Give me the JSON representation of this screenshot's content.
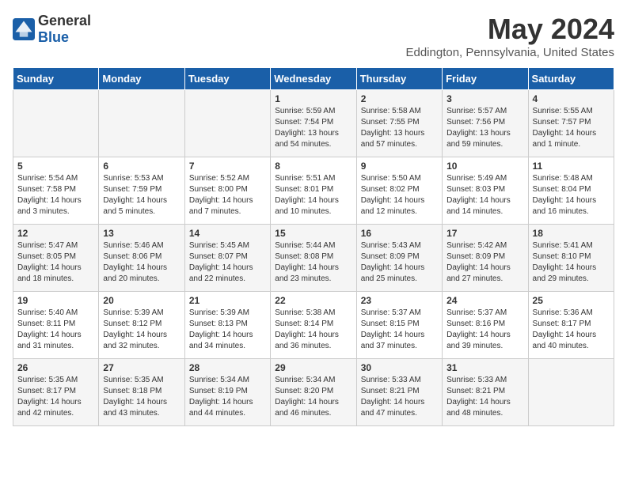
{
  "header": {
    "logo_general": "General",
    "logo_blue": "Blue",
    "title": "May 2024",
    "subtitle": "Eddington, Pennsylvania, United States"
  },
  "days_of_week": [
    "Sunday",
    "Monday",
    "Tuesday",
    "Wednesday",
    "Thursday",
    "Friday",
    "Saturday"
  ],
  "weeks": [
    [
      {
        "day": "",
        "info": ""
      },
      {
        "day": "",
        "info": ""
      },
      {
        "day": "",
        "info": ""
      },
      {
        "day": "1",
        "info": "Sunrise: 5:59 AM\nSunset: 7:54 PM\nDaylight: 13 hours\nand 54 minutes."
      },
      {
        "day": "2",
        "info": "Sunrise: 5:58 AM\nSunset: 7:55 PM\nDaylight: 13 hours\nand 57 minutes."
      },
      {
        "day": "3",
        "info": "Sunrise: 5:57 AM\nSunset: 7:56 PM\nDaylight: 13 hours\nand 59 minutes."
      },
      {
        "day": "4",
        "info": "Sunrise: 5:55 AM\nSunset: 7:57 PM\nDaylight: 14 hours\nand 1 minute."
      }
    ],
    [
      {
        "day": "5",
        "info": "Sunrise: 5:54 AM\nSunset: 7:58 PM\nDaylight: 14 hours\nand 3 minutes."
      },
      {
        "day": "6",
        "info": "Sunrise: 5:53 AM\nSunset: 7:59 PM\nDaylight: 14 hours\nand 5 minutes."
      },
      {
        "day": "7",
        "info": "Sunrise: 5:52 AM\nSunset: 8:00 PM\nDaylight: 14 hours\nand 7 minutes."
      },
      {
        "day": "8",
        "info": "Sunrise: 5:51 AM\nSunset: 8:01 PM\nDaylight: 14 hours\nand 10 minutes."
      },
      {
        "day": "9",
        "info": "Sunrise: 5:50 AM\nSunset: 8:02 PM\nDaylight: 14 hours\nand 12 minutes."
      },
      {
        "day": "10",
        "info": "Sunrise: 5:49 AM\nSunset: 8:03 PM\nDaylight: 14 hours\nand 14 minutes."
      },
      {
        "day": "11",
        "info": "Sunrise: 5:48 AM\nSunset: 8:04 PM\nDaylight: 14 hours\nand 16 minutes."
      }
    ],
    [
      {
        "day": "12",
        "info": "Sunrise: 5:47 AM\nSunset: 8:05 PM\nDaylight: 14 hours\nand 18 minutes."
      },
      {
        "day": "13",
        "info": "Sunrise: 5:46 AM\nSunset: 8:06 PM\nDaylight: 14 hours\nand 20 minutes."
      },
      {
        "day": "14",
        "info": "Sunrise: 5:45 AM\nSunset: 8:07 PM\nDaylight: 14 hours\nand 22 minutes."
      },
      {
        "day": "15",
        "info": "Sunrise: 5:44 AM\nSunset: 8:08 PM\nDaylight: 14 hours\nand 23 minutes."
      },
      {
        "day": "16",
        "info": "Sunrise: 5:43 AM\nSunset: 8:09 PM\nDaylight: 14 hours\nand 25 minutes."
      },
      {
        "day": "17",
        "info": "Sunrise: 5:42 AM\nSunset: 8:09 PM\nDaylight: 14 hours\nand 27 minutes."
      },
      {
        "day": "18",
        "info": "Sunrise: 5:41 AM\nSunset: 8:10 PM\nDaylight: 14 hours\nand 29 minutes."
      }
    ],
    [
      {
        "day": "19",
        "info": "Sunrise: 5:40 AM\nSunset: 8:11 PM\nDaylight: 14 hours\nand 31 minutes."
      },
      {
        "day": "20",
        "info": "Sunrise: 5:39 AM\nSunset: 8:12 PM\nDaylight: 14 hours\nand 32 minutes."
      },
      {
        "day": "21",
        "info": "Sunrise: 5:39 AM\nSunset: 8:13 PM\nDaylight: 14 hours\nand 34 minutes."
      },
      {
        "day": "22",
        "info": "Sunrise: 5:38 AM\nSunset: 8:14 PM\nDaylight: 14 hours\nand 36 minutes."
      },
      {
        "day": "23",
        "info": "Sunrise: 5:37 AM\nSunset: 8:15 PM\nDaylight: 14 hours\nand 37 minutes."
      },
      {
        "day": "24",
        "info": "Sunrise: 5:37 AM\nSunset: 8:16 PM\nDaylight: 14 hours\nand 39 minutes."
      },
      {
        "day": "25",
        "info": "Sunrise: 5:36 AM\nSunset: 8:17 PM\nDaylight: 14 hours\nand 40 minutes."
      }
    ],
    [
      {
        "day": "26",
        "info": "Sunrise: 5:35 AM\nSunset: 8:17 PM\nDaylight: 14 hours\nand 42 minutes."
      },
      {
        "day": "27",
        "info": "Sunrise: 5:35 AM\nSunset: 8:18 PM\nDaylight: 14 hours\nand 43 minutes."
      },
      {
        "day": "28",
        "info": "Sunrise: 5:34 AM\nSunset: 8:19 PM\nDaylight: 14 hours\nand 44 minutes."
      },
      {
        "day": "29",
        "info": "Sunrise: 5:34 AM\nSunset: 8:20 PM\nDaylight: 14 hours\nand 46 minutes."
      },
      {
        "day": "30",
        "info": "Sunrise: 5:33 AM\nSunset: 8:21 PM\nDaylight: 14 hours\nand 47 minutes."
      },
      {
        "day": "31",
        "info": "Sunrise: 5:33 AM\nSunset: 8:21 PM\nDaylight: 14 hours\nand 48 minutes."
      },
      {
        "day": "",
        "info": ""
      }
    ]
  ]
}
